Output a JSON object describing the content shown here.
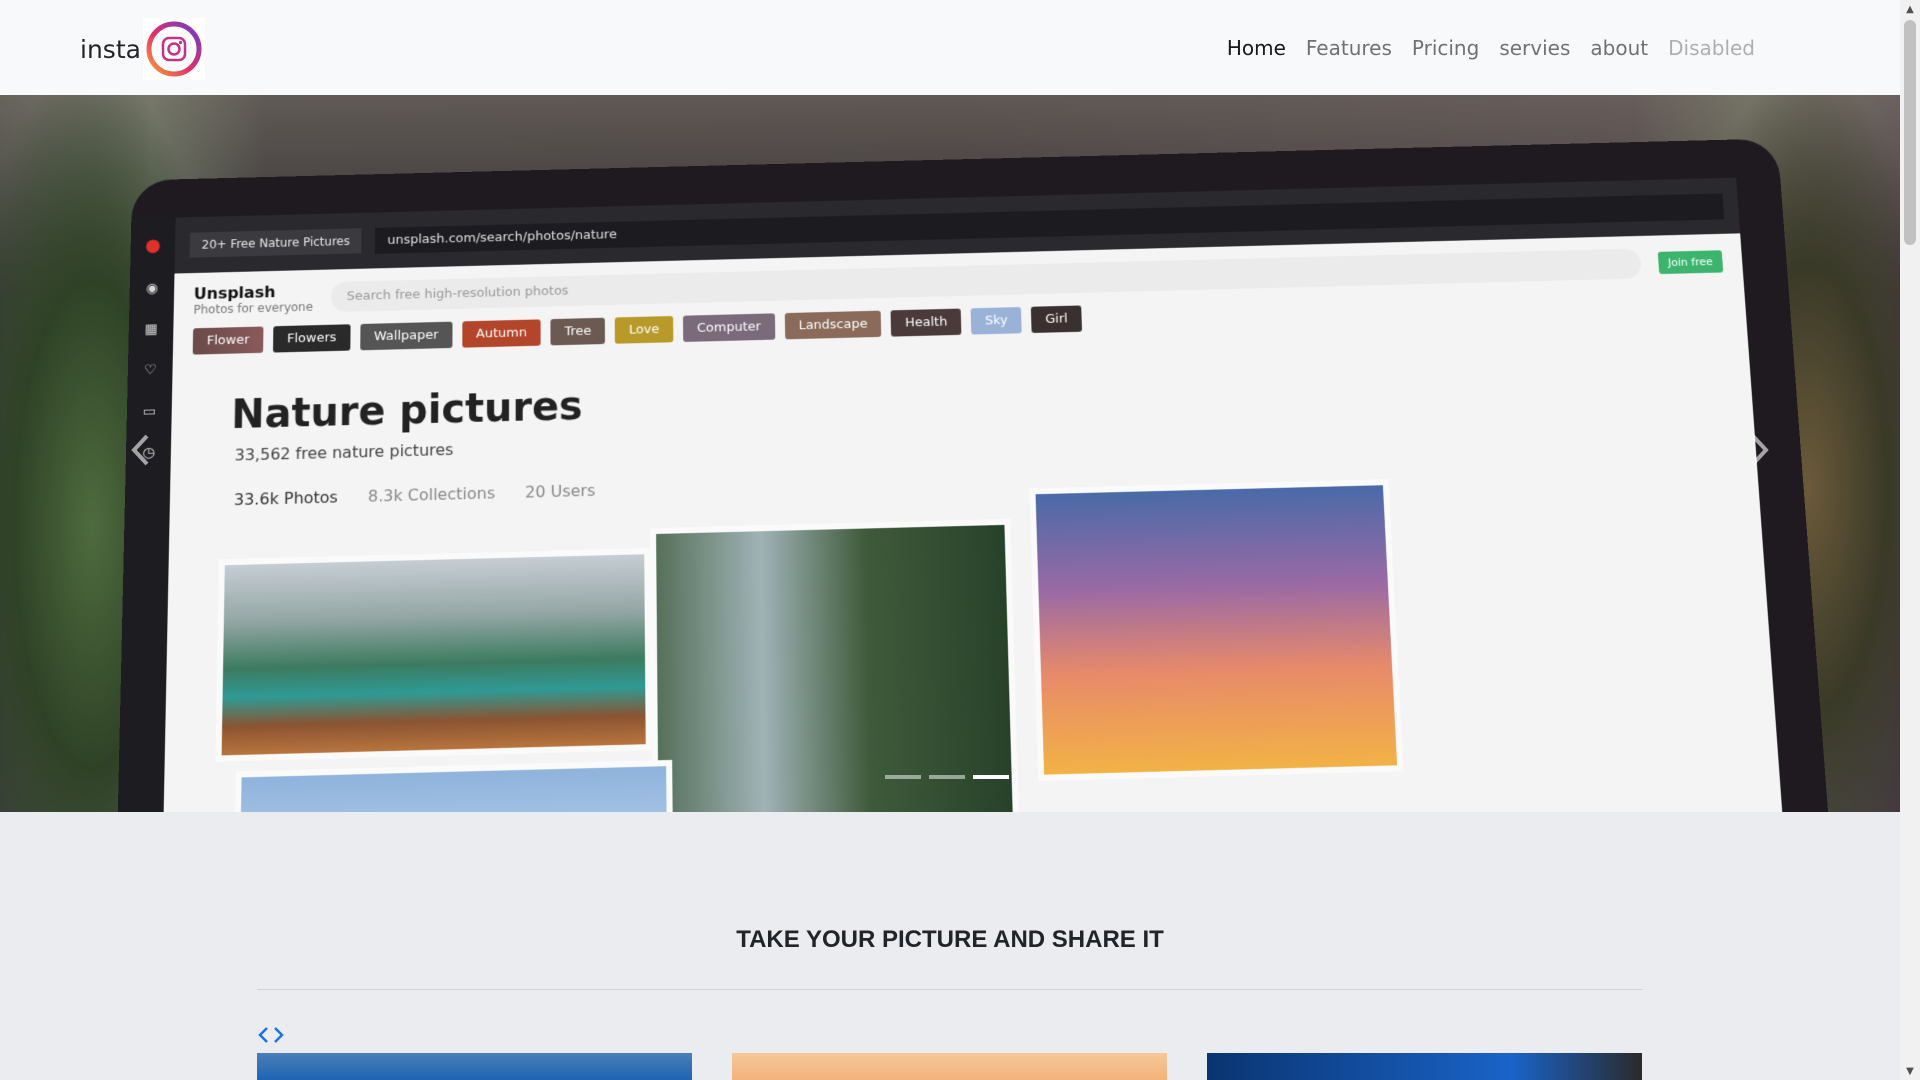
{
  "navbar": {
    "brand_text": "insta",
    "brand_logo_icon": "instagram-icon",
    "links": [
      {
        "label": "Home",
        "state": "active"
      },
      {
        "label": "Features",
        "state": "normal"
      },
      {
        "label": "Pricing",
        "state": "normal"
      },
      {
        "label": "servies",
        "state": "normal"
      },
      {
        "label": "about",
        "state": "normal"
      },
      {
        "label": "Disabled",
        "state": "disabled"
      }
    ]
  },
  "carousel": {
    "prev_icon": "chevron-left-icon",
    "next_icon": "chevron-right-icon",
    "indicators_count": 3,
    "active_indicator": 3,
    "slide": {
      "browser_tab": "20+ Free Nature Pictures",
      "url": "unsplash.com/search/photos/nature",
      "site_name": "Unsplash",
      "site_tagline": "Photos for everyone",
      "search_placeholder": "Search free high-resolution photos",
      "join_label": "Join free",
      "chips": [
        "Flower",
        "Flowers",
        "Wallpaper",
        "Autumn",
        "Tree",
        "Love",
        "Computer",
        "Landscape",
        "Health",
        "Sky",
        "Girl"
      ],
      "heading": "Nature pictures",
      "subheading": "33,562 free nature pictures",
      "stats": [
        "33.6k Photos",
        "8.3k Collections",
        "20 Users"
      ]
    }
  },
  "section": {
    "title": "TAKE YOUR PICTURE AND SHARE IT",
    "arrow_prev": "‹",
    "arrow_next": "›"
  },
  "colors": {
    "navbar_bg": "#f8f9fa",
    "page_bg": "#eaecef",
    "link_accent": "#1a73e8"
  }
}
